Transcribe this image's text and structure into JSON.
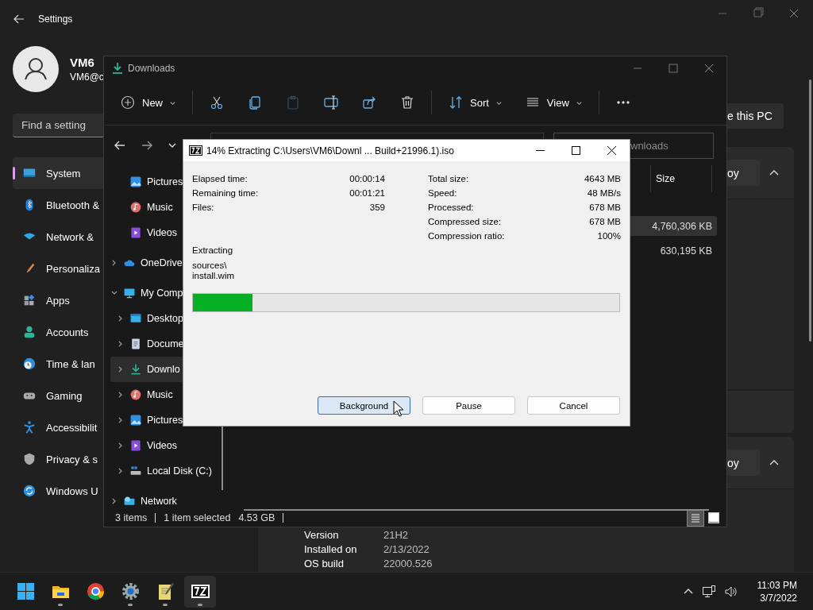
{
  "settings": {
    "title": "Settings",
    "user": {
      "name": "VM6",
      "email": "VM6@c"
    },
    "search": {
      "placeholder": "Find a setting"
    },
    "nav": [
      {
        "kind": "system",
        "label": "System",
        "selected": true
      },
      {
        "kind": "bluetooth",
        "label": "Bluetooth &",
        "selected": false
      },
      {
        "kind": "network",
        "label": "Network &",
        "selected": false
      },
      {
        "kind": "personalization",
        "label": "Personaliza",
        "selected": false
      },
      {
        "kind": "apps",
        "label": "Apps",
        "selected": false
      },
      {
        "kind": "accounts",
        "label": "Accounts",
        "selected": false
      },
      {
        "kind": "time",
        "label": "Time & lan",
        "selected": false
      },
      {
        "kind": "gaming",
        "label": "Gaming",
        "selected": false
      },
      {
        "kind": "accessibility",
        "label": "Accessibilit",
        "selected": false
      },
      {
        "kind": "privacy",
        "label": "Privacy & s",
        "selected": false
      },
      {
        "kind": "update",
        "label": "Windows U",
        "selected": false
      }
    ],
    "rename_button": "e this PC",
    "sections": [
      {
        "copy_button": "oy",
        "expanded": true
      },
      {
        "copy_button": "oy",
        "expanded": true
      }
    ],
    "specs": [
      {
        "label": "Version",
        "value": "21H2"
      },
      {
        "label": "Installed on",
        "value": "2/13/2022"
      },
      {
        "label": "OS build",
        "value": "22000.526"
      }
    ]
  },
  "explorer": {
    "title": "Downloads",
    "toolbar": [
      {
        "kind": "menu",
        "label": "New"
      },
      {
        "kind": "divider"
      },
      {
        "kind": "icon",
        "disabled": false
      },
      {
        "kind": "icon",
        "disabled": false
      },
      {
        "kind": "icon",
        "disabled": true
      },
      {
        "kind": "icon",
        "disabled": false
      },
      {
        "kind": "icon",
        "disabled": false
      },
      {
        "kind": "icon",
        "disabled": false
      },
      {
        "kind": "divider"
      },
      {
        "kind": "menu",
        "label": "Sort"
      },
      {
        "kind": "menu",
        "label": "View"
      },
      {
        "kind": "divider"
      },
      {
        "kind": "more"
      }
    ],
    "search": {
      "placeholder": "wnloads"
    },
    "quick_access": [
      {
        "kind": "pictures",
        "label": "Pictures",
        "selected": false
      },
      {
        "kind": "music",
        "label": "Music",
        "selected": false
      },
      {
        "kind": "videos",
        "label": "Videos",
        "selected": false
      }
    ],
    "tree": [
      {
        "kind": "cloud",
        "label": "OneDrive",
        "expanded": false,
        "selected": false
      },
      {
        "kind": "pc",
        "label": "My Comp",
        "expanded": true,
        "selected": false,
        "children": [
          {
            "kind": "desktop",
            "label": "Desktop",
            "expanded": false,
            "selected": false
          },
          {
            "kind": "documents",
            "label": "Docume",
            "expanded": false,
            "selected": false
          },
          {
            "kind": "downloads",
            "label": "Downlo",
            "expanded": false,
            "selected": true
          },
          {
            "kind": "music",
            "label": "Music",
            "expanded": false,
            "selected": false
          },
          {
            "kind": "pictures",
            "label": "Pictures",
            "expanded": false,
            "selected": false
          },
          {
            "kind": "videos",
            "label": "Videos",
            "expanded": false,
            "selected": false
          },
          {
            "kind": "drive",
            "label": "Local Disk (C:)",
            "expanded": false,
            "selected": false
          }
        ]
      },
      {
        "kind": "network",
        "label": "Network",
        "expanded": false,
        "selected": false
      }
    ],
    "columns": [
      "Size"
    ],
    "rows": [
      {
        "size": "4,760,306 KB",
        "selected": true
      },
      {
        "size": "630,195 KB",
        "selected": false
      }
    ],
    "status": {
      "items": "3 items",
      "selection": "1 item selected",
      "size": "4.53 GB"
    },
    "views": [
      {
        "kind": "details",
        "selected": true
      },
      {
        "kind": "preview",
        "selected": false
      }
    ]
  },
  "dialog": {
    "title": "14% Extracting C:\\Users\\VM6\\Downl ... Build+21996.1).iso",
    "left_stats": [
      {
        "label": "Elapsed time:",
        "value": "00:00:14"
      },
      {
        "label": "Remaining time:",
        "value": "00:01:21"
      },
      {
        "label": "Files:",
        "value": "359"
      }
    ],
    "right_stats": [
      {
        "label": "Total size:",
        "value": "4643 MB"
      },
      {
        "label": "Speed:",
        "value": "48 MB/s"
      },
      {
        "label": "Processed:",
        "value": "678 MB"
      },
      {
        "label": "Compressed size:",
        "value": "678 MB"
      },
      {
        "label": "Compression ratio:",
        "value": "100%"
      }
    ],
    "action": "Extracting",
    "file_lines": [
      "sources\\",
      "install.wim"
    ],
    "progress": {
      "level": 0.14
    },
    "buttons": [
      {
        "label": "Background",
        "focused": true
      },
      {
        "label": "Pause",
        "focused": false
      },
      {
        "label": "Cancel",
        "focused": false
      }
    ]
  },
  "taskbar": {
    "apps": [
      {
        "kind": "start",
        "running": false,
        "active": false
      },
      {
        "kind": "explorer",
        "running": true,
        "active": false
      },
      {
        "kind": "chrome",
        "running": false,
        "active": false
      },
      {
        "kind": "settings",
        "running": true,
        "active": false
      },
      {
        "kind": "notepad",
        "running": true,
        "active": false
      },
      {
        "kind": "sevenzip",
        "running": true,
        "active": true
      }
    ],
    "time": "11:03 PM",
    "date": "3/7/2022"
  }
}
